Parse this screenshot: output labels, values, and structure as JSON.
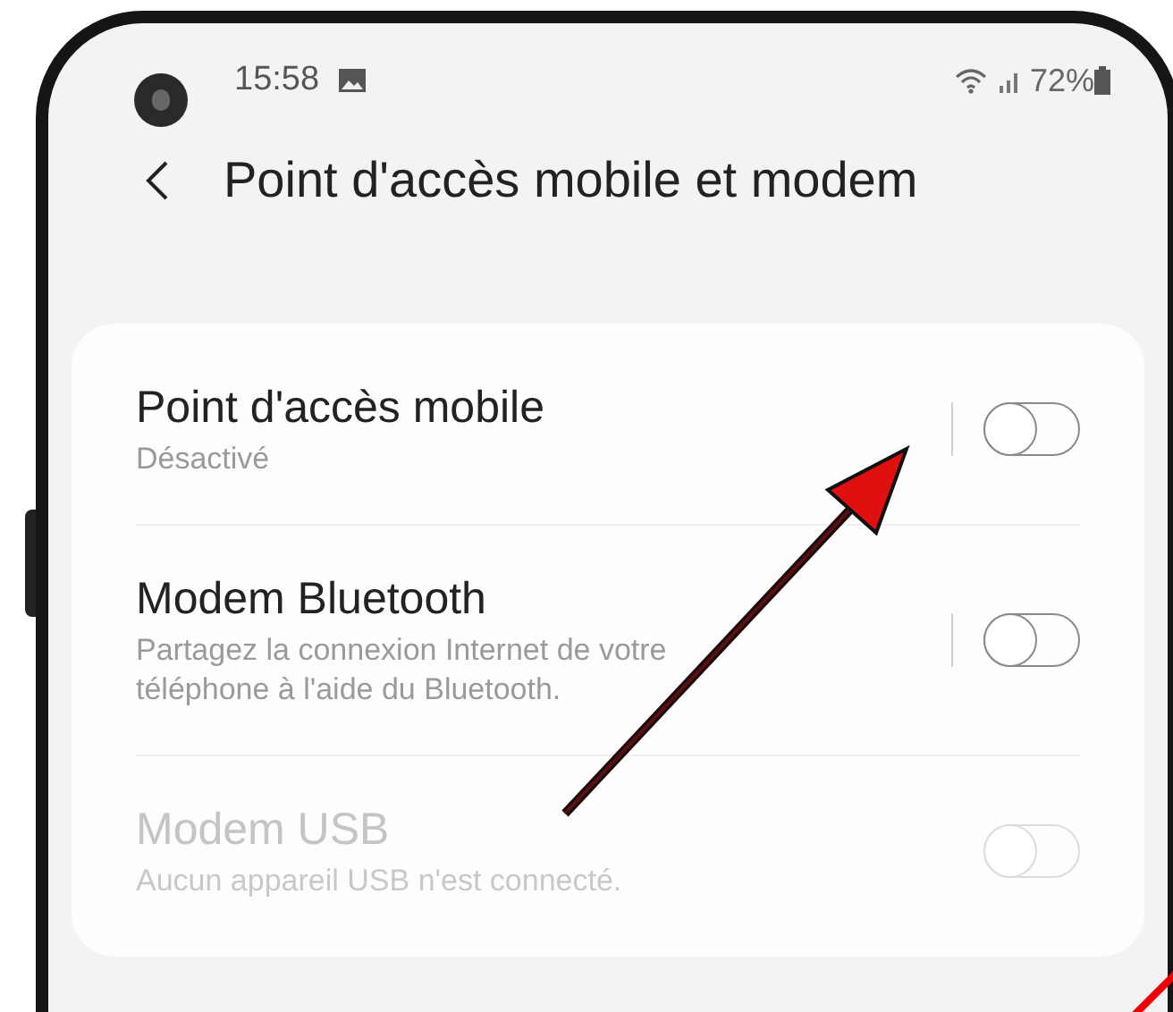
{
  "status_bar": {
    "time": "15:58",
    "battery": "72%"
  },
  "header": {
    "title": "Point d'accès mobile et modem"
  },
  "settings": [
    {
      "title": "Point d'accès mobile",
      "subtitle": "Désactivé",
      "on": false,
      "disabled": false
    },
    {
      "title": "Modem Bluetooth",
      "subtitle": "Partagez la connexion Internet de votre téléphone à l'aide du Bluetooth.",
      "on": false,
      "disabled": false
    },
    {
      "title": "Modem USB",
      "subtitle": "Aucun appareil USB n'est connecté.",
      "on": false,
      "disabled": true
    }
  ]
}
